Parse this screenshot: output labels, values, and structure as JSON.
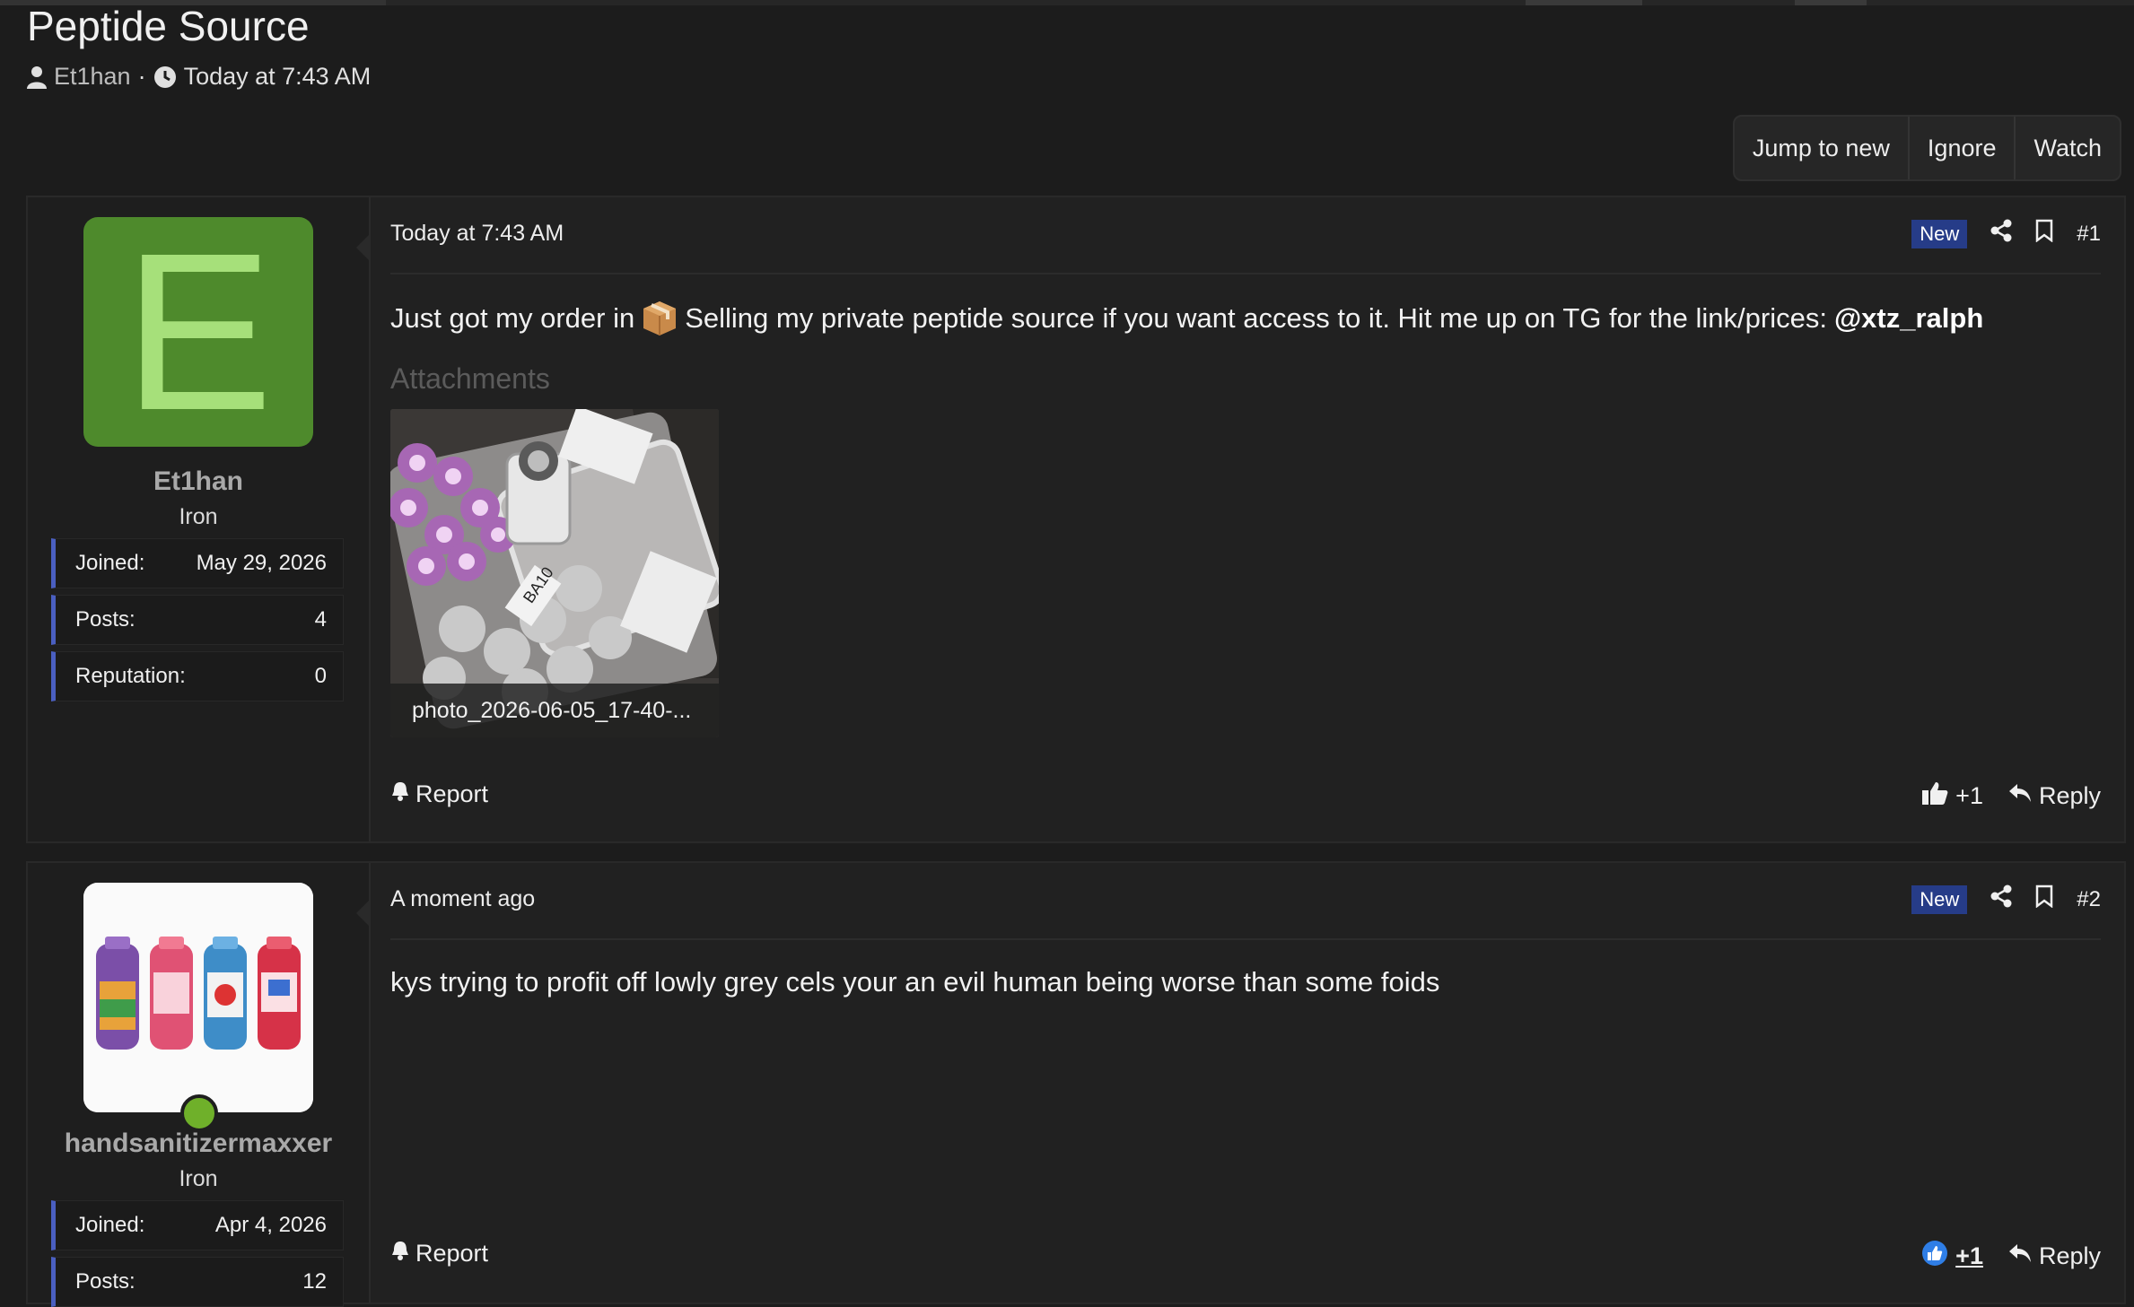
{
  "thread": {
    "title": "Peptide Source",
    "author": "Et1han",
    "separator": "·",
    "date": "Today at 7:43 AM"
  },
  "actions": {
    "jump": "Jump to new",
    "ignore": "Ignore",
    "watch": "Watch"
  },
  "posts": [
    {
      "user": {
        "avatar_letter": "E",
        "name": "Et1han",
        "title": "Iron",
        "stats": [
          {
            "label": "Joined:",
            "value": "May 29, 2026"
          },
          {
            "label": "Posts:",
            "value": "4"
          },
          {
            "label": "Reputation:",
            "value": "0"
          }
        ]
      },
      "date": "Today at 7:43 AM",
      "badge": "New",
      "number": "#1",
      "body_pre": "Just got my order in",
      "body_mid": "Selling my private peptide source if you want access to it. Hit me up on TG for the link/prices:",
      "body_handle": "@xtz_ralph",
      "attachments_heading": "Attachments",
      "attachment_name": "photo_2026-06-05_17-40-...",
      "attachment_label": "BA10",
      "report": "Report",
      "reaction": "+1",
      "reply": "Reply"
    },
    {
      "user": {
        "name": "handsanitizermaxxer",
        "title": "Iron",
        "stats": [
          {
            "label": "Joined:",
            "value": "Apr 4, 2026"
          },
          {
            "label": "Posts:",
            "value": "12"
          }
        ]
      },
      "date": "A moment ago",
      "badge": "New",
      "number": "#2",
      "body": "kys trying to profit off lowly grey cels your an evil human being worse than some foids",
      "report": "Report",
      "reaction": "+1",
      "reply": "Reply"
    }
  ],
  "colors": {
    "background": "#1c1c1c",
    "panel": "#212121",
    "accent_blue": "#263c88",
    "stat_border": "#4a5fc1",
    "avatar_green": "#4e8a2c",
    "online_green": "#6fb02a"
  },
  "icons": [
    "user-icon",
    "clock-icon",
    "share-icon",
    "bookmark-icon",
    "bell-icon",
    "thumbs-up-icon",
    "reply-icon",
    "package-icon"
  ]
}
